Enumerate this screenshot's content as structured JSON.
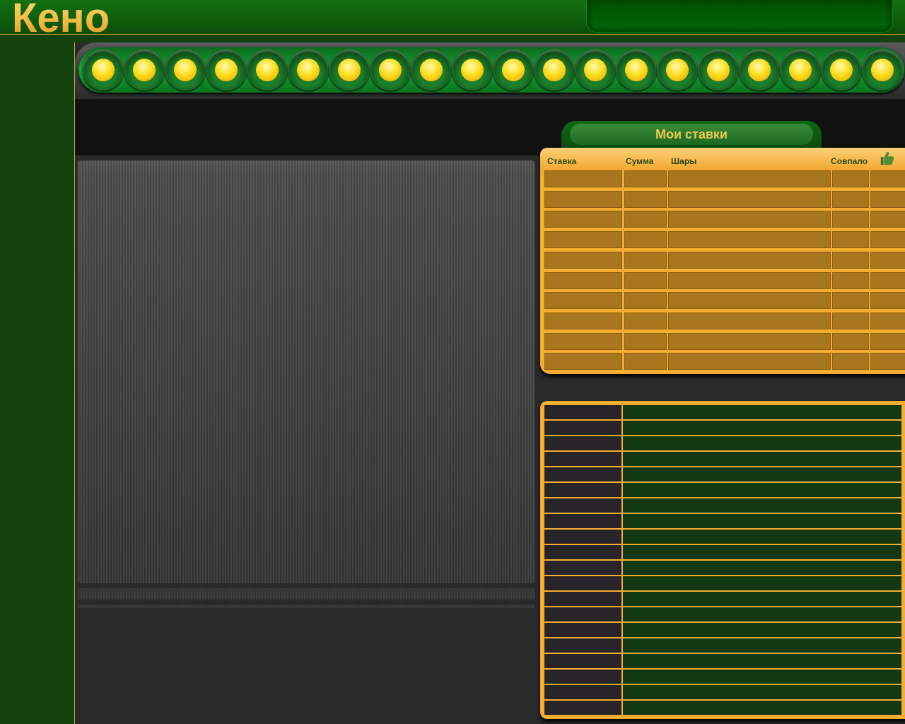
{
  "app": {
    "title": "Кено"
  },
  "draw": {
    "ball_count": 20
  },
  "bets": {
    "tab_title": "Мои ставки",
    "columns": [
      "Ставка",
      "Сумма",
      "Шары",
      "Совпало"
    ],
    "rows": 10,
    "icon": "thumbs-up-icon"
  },
  "results": {
    "rows": 20
  },
  "colors": {
    "accent": "#f4ad31",
    "title_gold": "#f0c850",
    "header_green": "#14700f",
    "ball_yellow": "#ffdf20"
  }
}
